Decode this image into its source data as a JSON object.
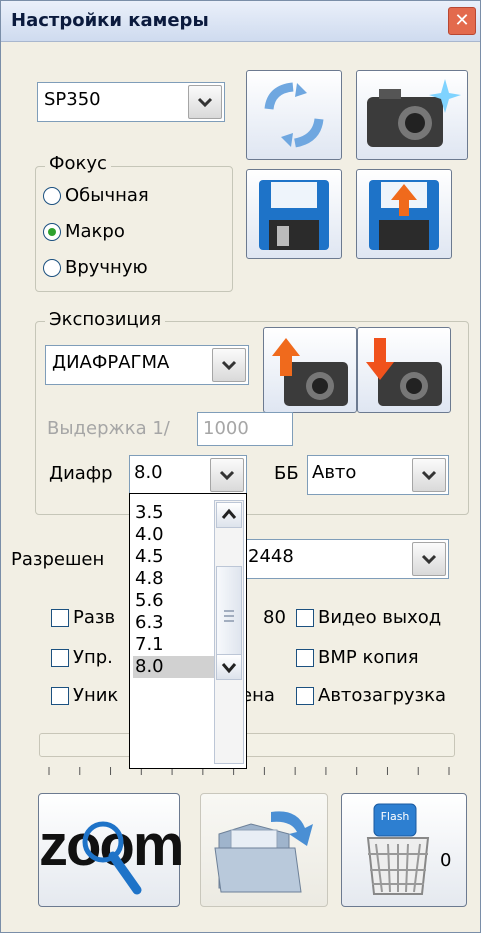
{
  "window": {
    "title": "Настройки камеры"
  },
  "camera_model": {
    "value": "SP350"
  },
  "focus": {
    "legend": "Фокус",
    "options": [
      {
        "label": "Обычная",
        "selected": false
      },
      {
        "label": "Макро",
        "selected": true
      },
      {
        "label": "Вручную",
        "selected": false
      }
    ]
  },
  "exposure": {
    "legend": "Экспозиция",
    "mode": "ДИАФРАГМА",
    "shutter_label": "Выдержка 1/",
    "shutter_value": "1000",
    "aperture_label": "Диафр",
    "aperture_value": "8.0",
    "wb_label": "ББ",
    "wb_value": "Авто"
  },
  "aperture_dropdown": {
    "options": [
      "3.5",
      "4.0",
      "4.5",
      "4.8",
      "5.6",
      "6.3",
      "7.1",
      "8.0"
    ],
    "selected": "8.0"
  },
  "resolution": {
    "label_visible": "Разрешен",
    "value_visible": "2448"
  },
  "checkboxes": [
    {
      "label": "Разв",
      "checked": false
    },
    {
      "label": "80",
      "checked": false
    },
    {
      "label": "Видео выход",
      "checked": false
    },
    {
      "label": "Упр.",
      "checked": false
    },
    {
      "label": "BMP копия",
      "checked": false
    },
    {
      "label": "Уник",
      "checked": false
    },
    {
      "label": "ена",
      "checked": false
    },
    {
      "label": "Автозагрузка",
      "checked": false
    }
  ],
  "slider": {
    "ticks": 14,
    "value_fraction": 0.27
  },
  "zoom_button": {
    "text": "zoom"
  },
  "flash_button": {
    "badge": "Flash",
    "count": "0"
  },
  "colors": {
    "accent": "#2e6fb5",
    "titlebar": "#cfdbef",
    "selection": "#d1d1d1",
    "check": "#2ea12e"
  }
}
